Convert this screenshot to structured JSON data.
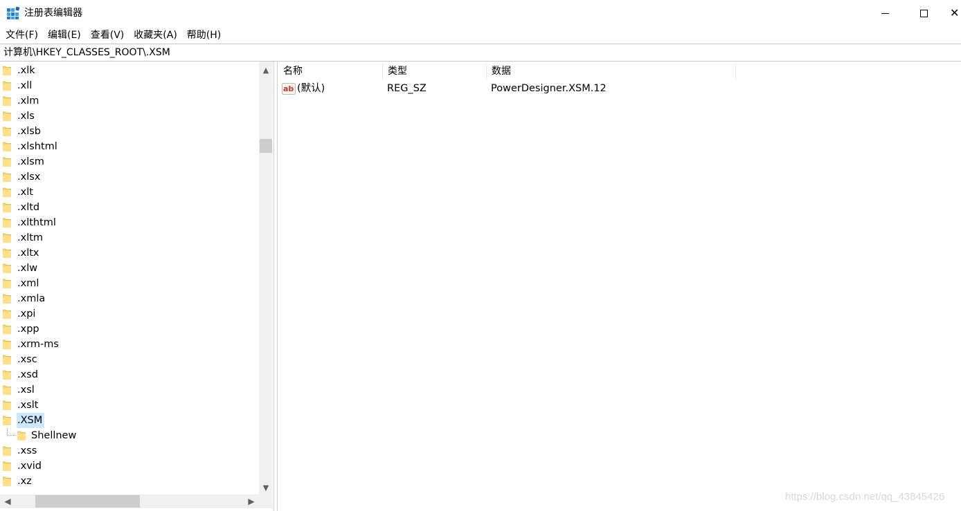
{
  "window": {
    "title": "注册表编辑器",
    "close_glyph": "✕"
  },
  "menu": {
    "items": [
      "文件(F)",
      "编辑(E)",
      "查看(V)",
      "收藏夹(A)",
      "帮助(H)"
    ]
  },
  "address": {
    "path": "计算机\\HKEY_CLASSES_ROOT\\.XSM"
  },
  "tree": {
    "items": [
      {
        "label": ".xlk"
      },
      {
        "label": ".xll"
      },
      {
        "label": ".xlm"
      },
      {
        "label": ".xls"
      },
      {
        "label": ".xlsb"
      },
      {
        "label": ".xlshtml"
      },
      {
        "label": ".xlsm"
      },
      {
        "label": ".xlsx"
      },
      {
        "label": ".xlt"
      },
      {
        "label": ".xltd"
      },
      {
        "label": ".xlthtml"
      },
      {
        "label": ".xltm"
      },
      {
        "label": ".xltx"
      },
      {
        "label": ".xlw"
      },
      {
        "label": ".xml"
      },
      {
        "label": ".xmla"
      },
      {
        "label": ".xpi"
      },
      {
        "label": ".xpp"
      },
      {
        "label": ".xrm-ms"
      },
      {
        "label": ".xsc"
      },
      {
        "label": ".xsd"
      },
      {
        "label": ".xsl"
      },
      {
        "label": ".xslt"
      },
      {
        "label": ".XSM",
        "selected": true
      },
      {
        "label": "Shellnew",
        "child": true
      },
      {
        "label": ".xss"
      },
      {
        "label": ".xvid"
      },
      {
        "label": ".xz"
      }
    ],
    "folder_color": "#f8d775"
  },
  "list": {
    "columns": {
      "name": "名称",
      "type": "类型",
      "data": "数据"
    },
    "rows": [
      {
        "name": "(默认)",
        "type": "REG_SZ",
        "data": "PowerDesigner.XSM.12",
        "icon": "string-value-icon"
      }
    ]
  },
  "watermark": "https://blog.csdn.net/qq_43845426",
  "colors": {
    "selection": "#cce8ff",
    "scrollbar_track": "#f0f0f0",
    "scrollbar_thumb": "#cdcdcd"
  }
}
